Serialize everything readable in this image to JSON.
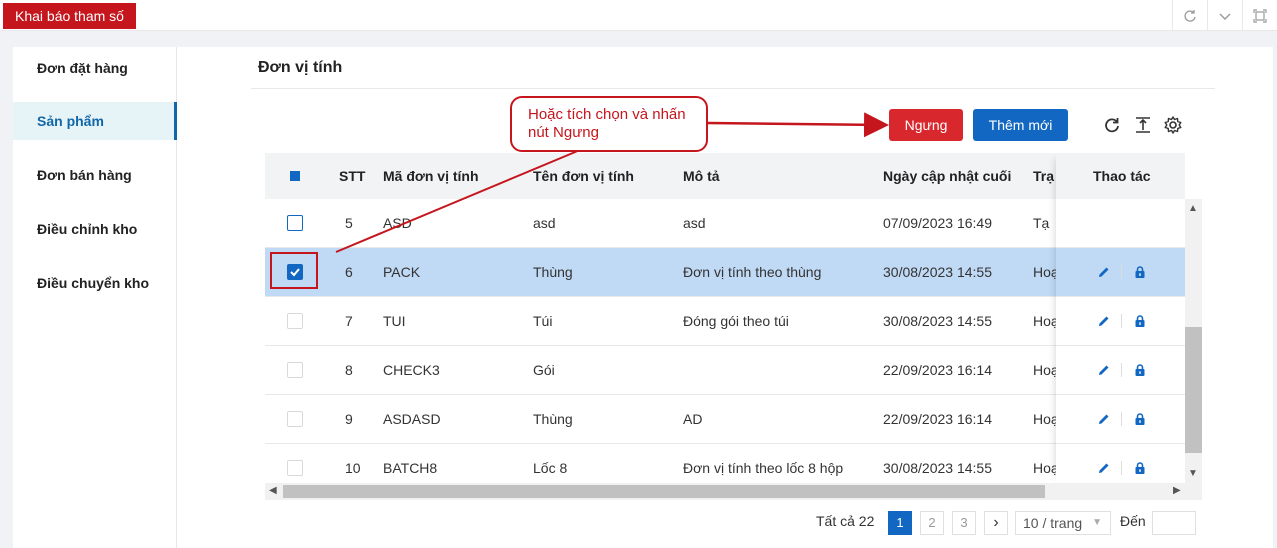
{
  "tabs": {
    "active_label": "Khai báo tham số"
  },
  "sidebar": {
    "items": [
      {
        "label": "Đơn đặt hàng"
      },
      {
        "label": "Sản phẩm"
      },
      {
        "label": "Đơn bán hàng"
      },
      {
        "label": "Điều chỉnh kho"
      },
      {
        "label": "Điều chuyển kho"
      }
    ],
    "active_index": 1
  },
  "page": {
    "title": "Đơn vị tính"
  },
  "toolbar": {
    "stop_label": "Ngưng",
    "add_label": "Thêm mới"
  },
  "annotation": {
    "text": "Hoặc tích chọn và nhấn nút Ngưng",
    "color": "#c4161c"
  },
  "table": {
    "headers": {
      "stt": "STT",
      "code": "Mã đơn vị tính",
      "name": "Tên đơn vị tính",
      "desc": "Mô tả",
      "updated": "Ngày cập nhật cuối",
      "status": "Trạ",
      "actions": "Thao tác"
    },
    "rows": [
      {
        "stt": "5",
        "code": "ASD",
        "name": "asd",
        "desc": "asd",
        "updated": "07/09/2023 16:49",
        "status": "Tạ",
        "checked": false,
        "selected": false,
        "actions": false
      },
      {
        "stt": "6",
        "code": "PACK",
        "name": "Thùng",
        "desc": "Đơn vị tính theo thùng",
        "updated": "30/08/2023 14:55",
        "status": "Hoạ",
        "checked": true,
        "selected": true,
        "actions": true
      },
      {
        "stt": "7",
        "code": "TUI",
        "name": "Túi",
        "desc": "Đóng gói theo túi",
        "updated": "30/08/2023 14:55",
        "status": "Hoạ",
        "checked": false,
        "selected": false,
        "actions": true
      },
      {
        "stt": "8",
        "code": "CHECK3",
        "name": "Gói",
        "desc": "",
        "updated": "22/09/2023 16:14",
        "status": "Hoạ",
        "checked": false,
        "selected": false,
        "actions": true
      },
      {
        "stt": "9",
        "code": "ASDASD",
        "name": "Thùng",
        "desc": "AD",
        "updated": "22/09/2023 16:14",
        "status": "Hoạ",
        "checked": false,
        "selected": false,
        "actions": true
      },
      {
        "stt": "10",
        "code": "BATCH8",
        "name": "Lốc 8",
        "desc": "Đơn vị tính theo lốc 8 hộp",
        "updated": "30/08/2023 14:55",
        "status": "Hoạ",
        "checked": false,
        "selected": false,
        "actions": true
      }
    ]
  },
  "pagination": {
    "total_label": "Tất cả 22",
    "pages": [
      "1",
      "2",
      "3"
    ],
    "current": "1",
    "next": "›",
    "page_size": "10 / trang",
    "goto_label": "Đến"
  },
  "colors": {
    "primary": "#1167c1",
    "danger": "#d9272e",
    "brand": "#c4161c",
    "selected_row": "#c0d9f5"
  }
}
